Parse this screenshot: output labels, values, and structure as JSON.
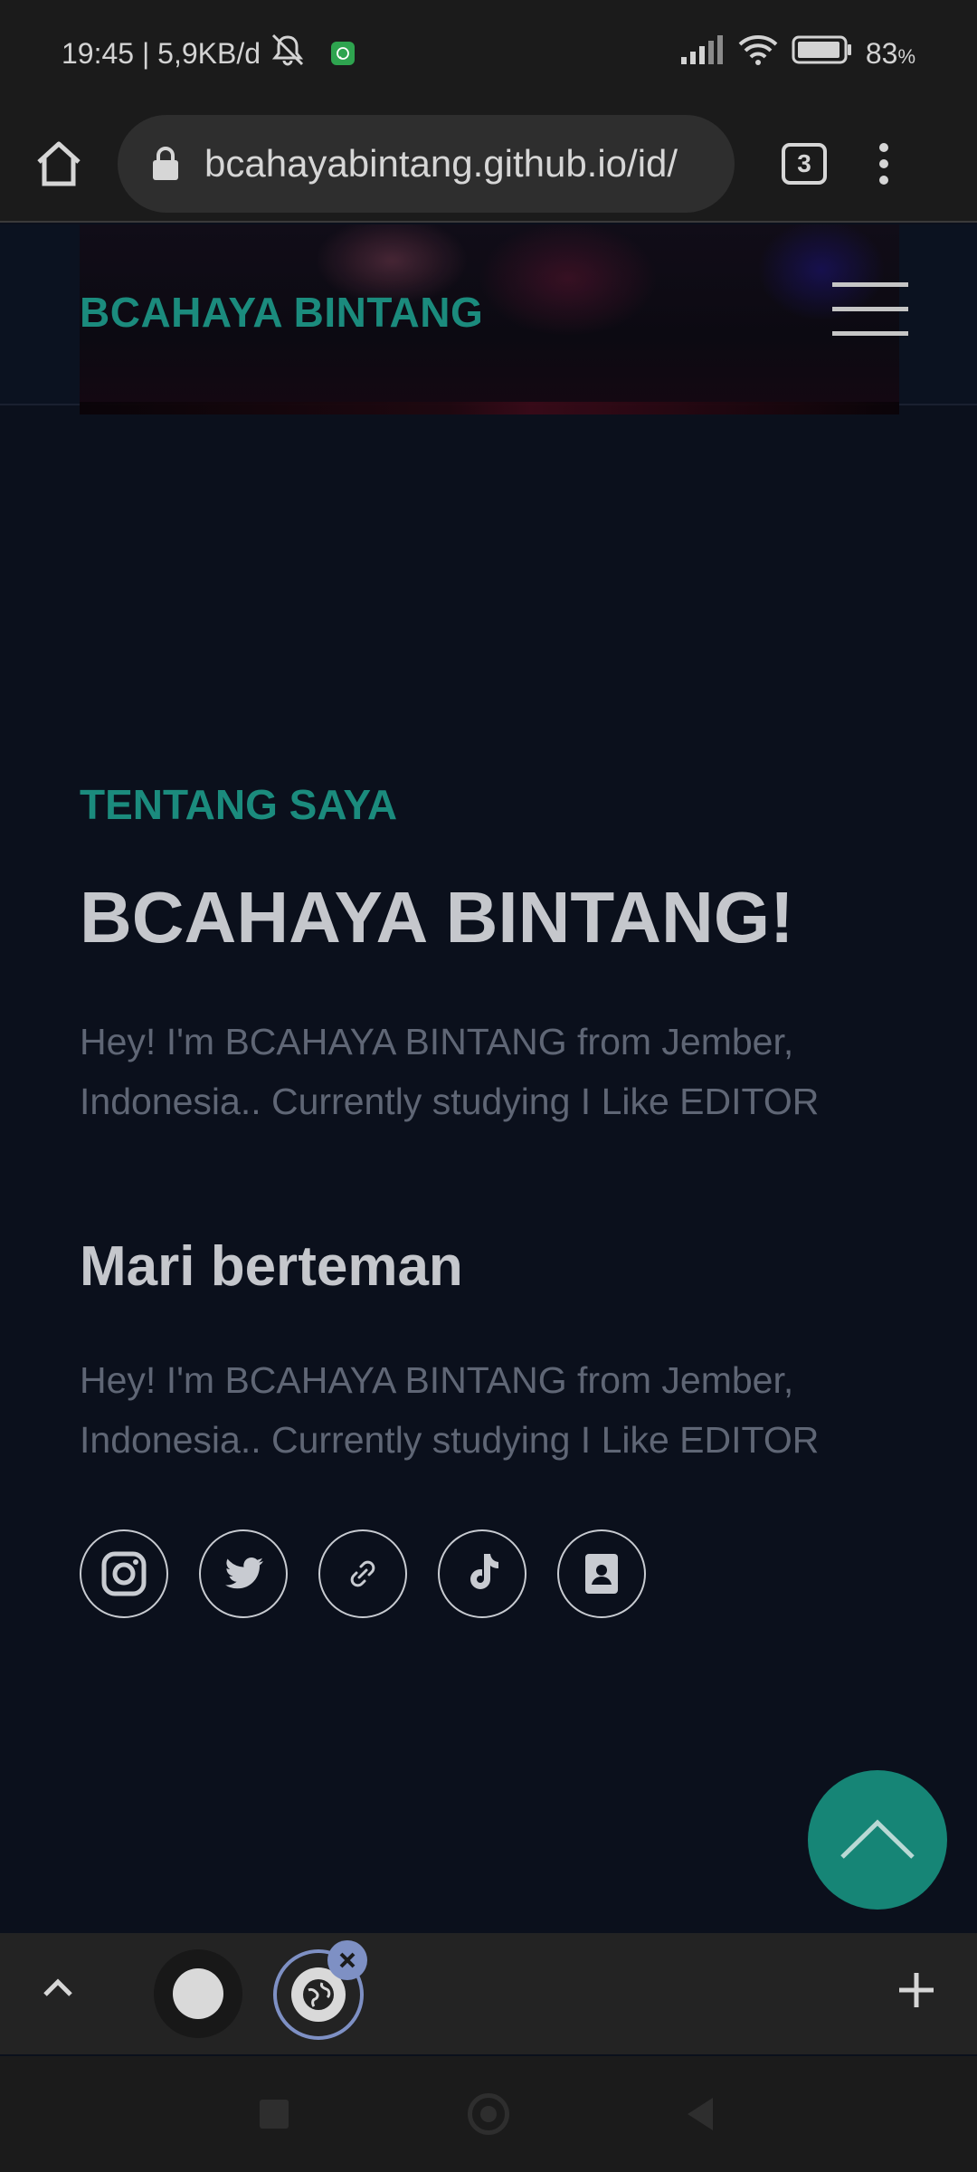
{
  "status_bar": {
    "time_speed": "19:45 | 5,9KB/d",
    "battery": "83",
    "battery_unit": "%"
  },
  "browser": {
    "url": "bcahayabintang.github.io/id/",
    "tab_count": "3"
  },
  "site": {
    "brand": "BCAHAYA BINTANG"
  },
  "about": {
    "label": "TENTANG SAYA",
    "title": "BCAHAYA BINTANG!",
    "text": "Hey! I'm BCAHAYA BINTANG from Jember, Indonesia.. Currently studying I Like EDITOR"
  },
  "friends": {
    "title": "Mari berteman",
    "text": "Hey! I'm BCAHAYA BINTANG from Jember, Indonesia.. Currently studying I Like EDITOR"
  },
  "socials": [
    "instagram-icon",
    "twitter-icon",
    "link-icon",
    "tiktok-icon",
    "contact-icon"
  ],
  "colors": {
    "accent": "#1b8b7d",
    "background": "#0b101c",
    "scroll_button": "#168576",
    "tab_highlight": "#7e90c4"
  }
}
